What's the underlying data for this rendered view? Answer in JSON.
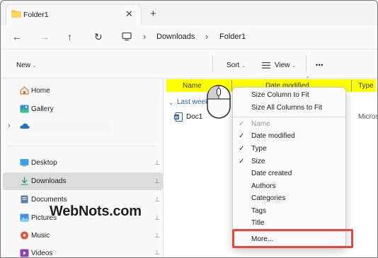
{
  "window": {
    "tab_title": "Folder1",
    "tab_close": "✕",
    "new_tab": "+"
  },
  "nav": {
    "back": "←",
    "forward": "→",
    "up": "↑",
    "refresh": "↻",
    "breadcrumb": [
      "Downloads",
      "Folder1"
    ],
    "separator": "›"
  },
  "toolbar": {
    "new_label": "New",
    "sort_label": "Sort",
    "view_label": "View",
    "more_label": "•••",
    "chevron": "⌄"
  },
  "sidebar": {
    "items": [
      {
        "label": "Home",
        "icon": "home-icon",
        "pinned": false
      },
      {
        "label": "Gallery",
        "icon": "gallery-icon",
        "pinned": false
      },
      {
        "label": "",
        "icon": "onedrive-icon",
        "pinned": false
      },
      {
        "label": "Desktop",
        "icon": "desktop-icon",
        "pinned": true
      },
      {
        "label": "Downloads",
        "icon": "downloads-icon",
        "pinned": true,
        "selected": true
      },
      {
        "label": "Documents",
        "icon": "documents-icon",
        "pinned": true
      },
      {
        "label": "Pictures",
        "icon": "pictures-icon",
        "pinned": true
      },
      {
        "label": "Music",
        "icon": "music-icon",
        "pinned": true
      },
      {
        "label": "Videos",
        "icon": "videos-icon",
        "pinned": true
      }
    ],
    "pin_glyph": "📌"
  },
  "columns": {
    "name": "Name",
    "date_modified": "Date modified",
    "type": "Type"
  },
  "files": {
    "group_label": "Last week",
    "items": [
      {
        "name": "Doc1",
        "type_truncated": "Micros"
      }
    ]
  },
  "context_menu": {
    "size_column": "Size Column to Fit",
    "size_all": "Size All Columns to Fit",
    "columns": [
      {
        "label": "Name",
        "checked": true,
        "disabled": true
      },
      {
        "label": "Date modified",
        "checked": true,
        "disabled": false
      },
      {
        "label": "Type",
        "checked": true,
        "disabled": false
      },
      {
        "label": "Size",
        "checked": true,
        "disabled": false
      },
      {
        "label": "Date created",
        "checked": false,
        "disabled": false
      },
      {
        "label": "Authors",
        "checked": false,
        "disabled": false
      },
      {
        "label": "Categories",
        "checked": false,
        "disabled": false
      },
      {
        "label": "Tags",
        "checked": false,
        "disabled": false
      },
      {
        "label": "Title",
        "checked": false,
        "disabled": false
      }
    ],
    "more": "More...",
    "check_glyph": "✓"
  },
  "watermark": "WebNots.com",
  "colors": {
    "highlight": "#ffff00",
    "annotation_box": "#e4473e",
    "folder": "#f5c242",
    "onedrive": "#1a73c9"
  }
}
